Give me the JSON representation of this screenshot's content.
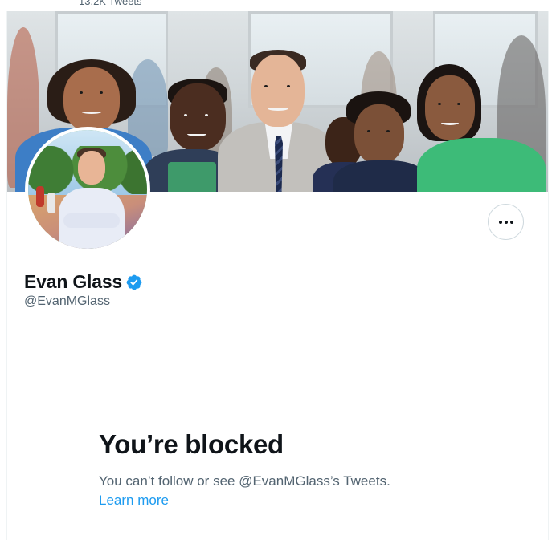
{
  "header": {
    "tweet_count": "13.2K Tweets"
  },
  "profile": {
    "display_name": "Evan Glass",
    "handle": "@EvanMGlass",
    "verified": true,
    "more_button_icon": "more-horizontal-icon"
  },
  "blocked": {
    "title": "You’re blocked",
    "description": "You can’t follow or see @EvanMGlass’s Tweets.",
    "learn_more": "Learn more"
  },
  "colors": {
    "accent": "#1d9bf0",
    "text_primary": "#0f1419",
    "text_secondary": "#536471",
    "border": "#cfd9de"
  }
}
